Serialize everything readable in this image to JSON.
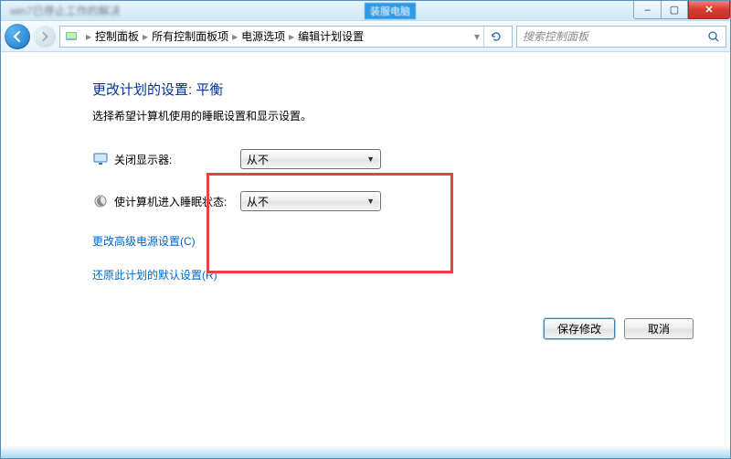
{
  "window": {
    "title_blur": "win7已停止工作的解决",
    "badge": "装服电脑",
    "min": "–",
    "max": "▢",
    "close": "✕"
  },
  "nav": {
    "breadcrumb": [
      "控制面板",
      "所有控制面板项",
      "电源选项",
      "编辑计划设置"
    ],
    "search_placeholder": "搜索控制面板"
  },
  "page": {
    "title": "更改计划的设置: 平衡",
    "subtitle": "选择希望计算机使用的睡眠设置和显示设置。",
    "settings": [
      {
        "label": "关闭显示器:",
        "value": "从不",
        "icon": "monitor"
      },
      {
        "label": "使计算机进入睡眠状态:",
        "value": "从不",
        "icon": "moon"
      }
    ],
    "links": {
      "advanced": "更改高级电源设置(C)",
      "restore": "还原此计划的默认设置(R)"
    },
    "buttons": {
      "save": "保存修改",
      "cancel": "取消"
    }
  }
}
